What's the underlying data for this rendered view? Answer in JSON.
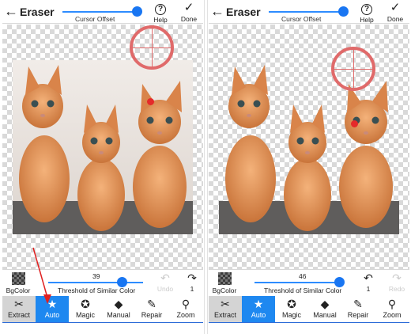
{
  "screens": [
    {
      "title": "Eraser",
      "offset_label": "Cursor Offset",
      "help_label": "Help",
      "done_label": "Done",
      "bgcolor_label": "BgColor",
      "threshold_value": "39",
      "threshold_label": "Threshold of Similar Color",
      "undo_label": "Undo",
      "redo_count": "1",
      "undo_enabled": false,
      "redo_enabled": true,
      "tools": [
        "Extract",
        "Auto",
        "Magic",
        "Manual",
        "Repair",
        "Zoom"
      ],
      "active_tool": "Auto"
    },
    {
      "title": "Eraser",
      "offset_label": "Cursor Offset",
      "help_label": "Help",
      "done_label": "Done",
      "bgcolor_label": "BgColor",
      "threshold_value": "46",
      "threshold_label": "Threshold of Similar Color",
      "undo_count": "1",
      "redo_label": "Redo",
      "undo_enabled": true,
      "redo_enabled": false,
      "tools": [
        "Extract",
        "Auto",
        "Magic",
        "Manual",
        "Repair",
        "Zoom"
      ],
      "active_tool": "Auto"
    }
  ],
  "colors": {
    "accent": "#1e88f0",
    "cursor_ring": "#e06a6a",
    "cursor_dot": "#e52a2a",
    "annotation_arrow": "#e02020"
  },
  "icons": {
    "back": "arrow-left-icon",
    "help": "question-circle-icon",
    "done": "checkmark-icon",
    "undo": "undo-icon",
    "redo": "redo-icon",
    "extract": "scissors-icon",
    "auto": "star-icon",
    "magic": "magic-star-icon",
    "manual": "eraser-icon",
    "repair": "brush-icon",
    "zoom": "magnifier-icon"
  }
}
